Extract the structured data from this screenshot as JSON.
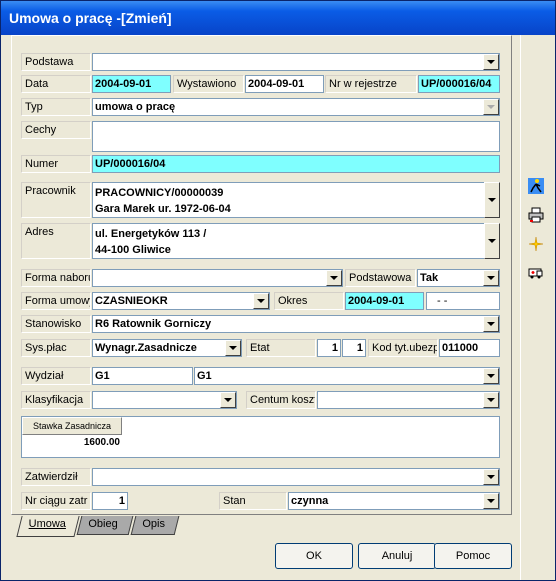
{
  "title": "Umowa o pracę -[Zmień]",
  "labels": {
    "podstawa": "Podstawa",
    "data": "Data",
    "wystawiono": "Wystawiono",
    "nr_rejestrze": "Nr w rejestrze",
    "typ": "Typ",
    "cechy": "Cechy",
    "numer": "Numer",
    "pracownik": "Pracownik",
    "adres": "Adres",
    "forma_naboru": "Forma naboru",
    "podstawowa": "Podstawowa",
    "forma_umowy": "Forma umowy",
    "okres": "Okres",
    "stanowisko": "Stanowisko",
    "sys_plac": "Sys.płac",
    "etat": "Etat",
    "kod_tyt": "Kod tyt.ubezp",
    "wydzial": "Wydział",
    "klasyfikacja": "Klasyfikacja",
    "centum": "Centum koszt.",
    "zatwierdzil": "Zatwierdził",
    "nr_ciagu": "Nr ciągu zatr",
    "stan": "Stan"
  },
  "values": {
    "podstawa": "",
    "data": "2004-09-01",
    "wystawiono": "2004-09-01",
    "nr_rejestrze": "UP/000016/04",
    "typ": "umowa o pracę",
    "cechy": "",
    "numer": "UP/000016/04",
    "pracownik_line1": "PRACOWNICY/00000039",
    "pracownik_line2": "Gara Marek ur. 1972-06-04",
    "adres_line1": "ul. Energetyków 113  /",
    "adres_line2": "44-100 Gliwice",
    "forma_naboru": "",
    "podstawowa": "Tak",
    "forma_umowy": "CZASNIEOKR",
    "okres_od": "2004-09-01",
    "okres_do": "- -",
    "stanowisko": "R6 Ratownik Gorniczy",
    "sys_plac": "Wynagr.Zasadnicze",
    "etat_num": "1",
    "etat_den": "1",
    "kod_tyt": "011000",
    "wydzial_code": "G1",
    "wydzial_name": "G1",
    "klasyfikacja": "",
    "centum": "",
    "zatwierdzil": "",
    "nr_ciagu": "1",
    "stan": "czynna"
  },
  "stawka": {
    "header": "Stawka Zasadnicza",
    "value": "1600.00"
  },
  "tabs": [
    "Umowa",
    "Obieg",
    "Opis"
  ],
  "buttons": {
    "ok": "OK",
    "anuluj": "Anuluj",
    "pomoc": "Pomoc"
  },
  "side_icons": [
    "person-run-icon",
    "printer-icon",
    "sparkle-icon",
    "ambulance-icon"
  ],
  "colors": {
    "title_bar": "#0a5ce6",
    "highlight_field": "#7fffff",
    "window_bg": "#ece9d8"
  }
}
